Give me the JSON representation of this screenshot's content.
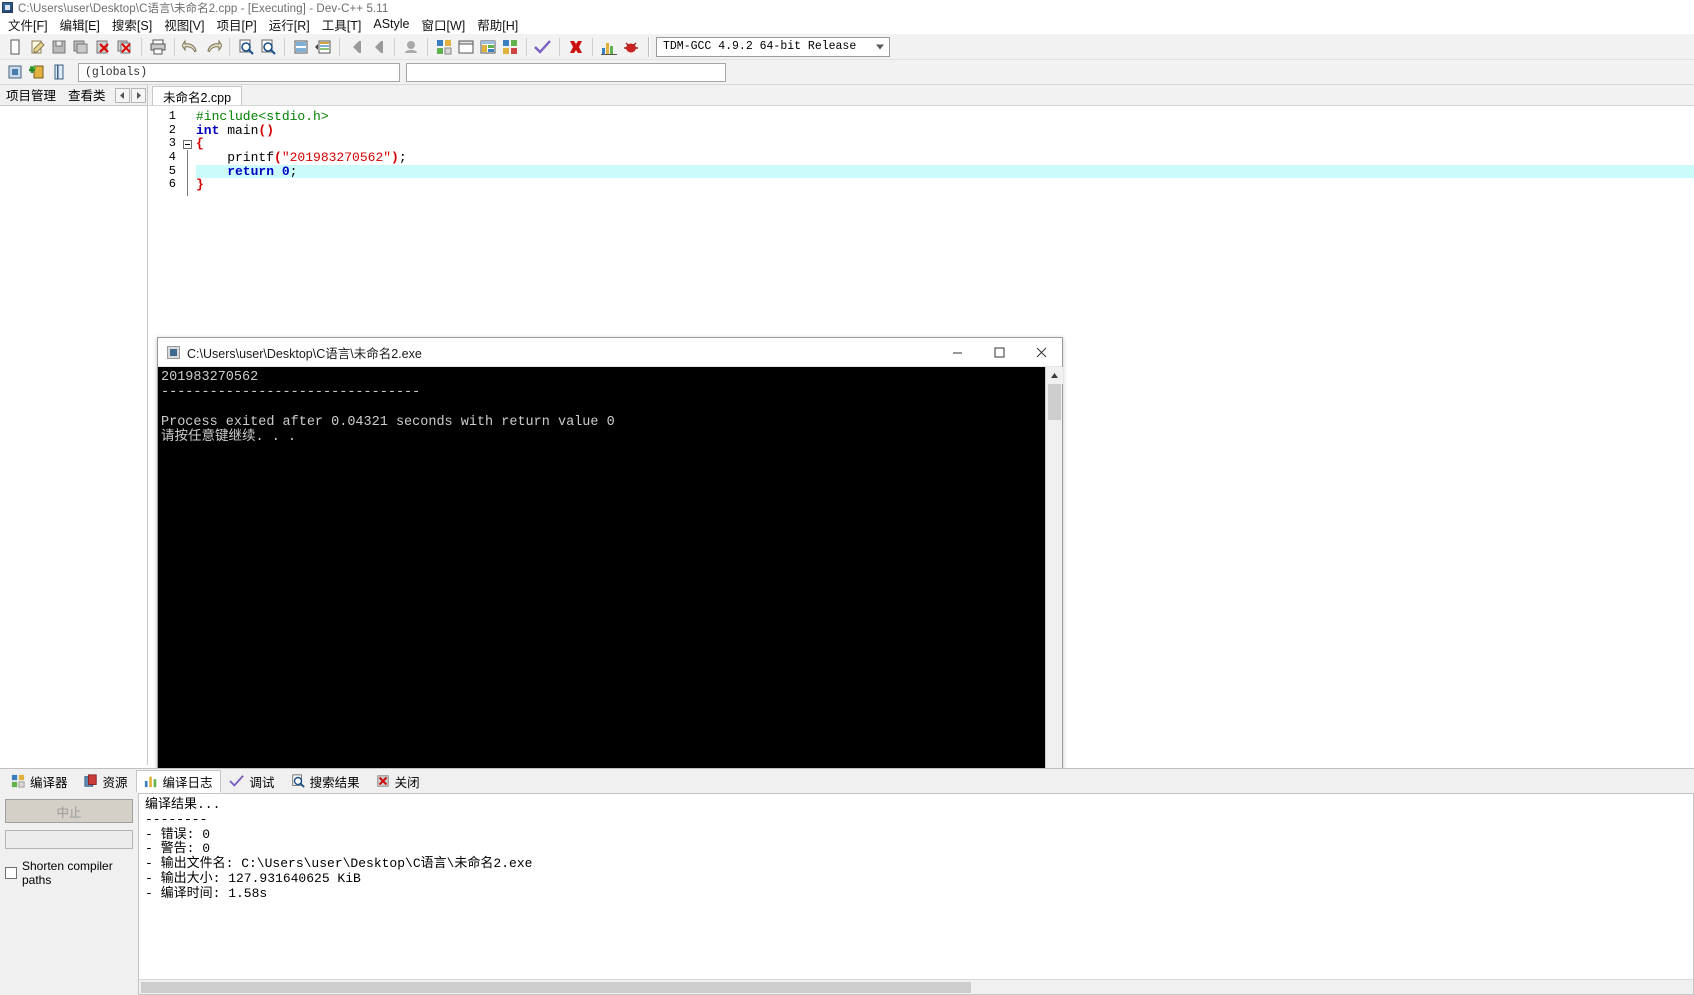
{
  "window": {
    "title": "C:\\Users\\user\\Desktop\\C语言\\未命名2.cpp - [Executing] - Dev-C++ 5.11",
    "icon": "app-icon"
  },
  "menubar": {
    "items": [
      {
        "label": "文件[F]"
      },
      {
        "label": "编辑[E]"
      },
      {
        "label": "搜索[S]"
      },
      {
        "label": "视图[V]"
      },
      {
        "label": "项目[P]"
      },
      {
        "label": "运行[R]"
      },
      {
        "label": "工具[T]"
      },
      {
        "label": "AStyle"
      },
      {
        "label": "窗口[W]"
      },
      {
        "label": "帮助[H]"
      }
    ]
  },
  "toolbar": {
    "buttons": [
      {
        "name": "new-file-icon"
      },
      {
        "name": "open-file-icon"
      },
      {
        "name": "save-file-icon"
      },
      {
        "name": "save-all-icon"
      },
      {
        "name": "close-file-icon"
      },
      {
        "name": "close-all-icon"
      },
      {
        "name": "print-icon"
      },
      {
        "name": "undo-icon"
      },
      {
        "name": "redo-icon"
      },
      {
        "name": "find-icon"
      },
      {
        "name": "replace-icon"
      },
      {
        "name": "goto-line-icon"
      },
      {
        "name": "indent-icon"
      },
      {
        "name": "back-icon"
      },
      {
        "name": "forward-icon"
      },
      {
        "name": "profile-icon"
      },
      {
        "name": "compile-icon"
      },
      {
        "name": "run-icon"
      },
      {
        "name": "compile-run-icon"
      },
      {
        "name": "rebuild-icon"
      },
      {
        "name": "syntax-check-icon"
      },
      {
        "name": "stop-execution-icon"
      },
      {
        "name": "profiling-icon"
      },
      {
        "name": "debug-icon"
      }
    ],
    "compiler_select": {
      "value": "TDM-GCC 4.9.2 64-bit Release"
    }
  },
  "toolbar2": {
    "buttons": [
      {
        "name": "project-browser-icon"
      },
      {
        "name": "add-class-icon"
      },
      {
        "name": "book-icon"
      }
    ],
    "scope_select": {
      "value": "(globals)"
    },
    "member_select": {
      "value": ""
    }
  },
  "left_panel": {
    "tabs": [
      {
        "label": "项目管理"
      },
      {
        "label": "查看类"
      }
    ],
    "nav_prev": "◄",
    "nav_next": "►"
  },
  "editor": {
    "tabs": [
      {
        "label": "未命名2.cpp",
        "active": true
      }
    ],
    "line_numbers": [
      "1",
      "2",
      "3",
      "4",
      "5",
      "6"
    ],
    "highlighted_line": 5,
    "code": [
      {
        "n": 1,
        "tokens": [
          {
            "t": "#include<stdio.h>",
            "c": "pp"
          }
        ]
      },
      {
        "n": 2,
        "tokens": [
          {
            "t": "int",
            "c": "kw"
          },
          {
            "t": " main",
            "c": "fn"
          },
          {
            "t": "()",
            "c": "br"
          }
        ]
      },
      {
        "n": 3,
        "tokens": [
          {
            "t": "{",
            "c": "brace"
          }
        ]
      },
      {
        "n": 4,
        "tokens": [
          {
            "t": "    printf",
            "c": "fn"
          },
          {
            "t": "(",
            "c": "br"
          },
          {
            "t": "\"201983270562\"",
            "c": "str"
          },
          {
            "t": ")",
            "c": "br"
          },
          {
            "t": ";",
            "c": "fn"
          }
        ]
      },
      {
        "n": 5,
        "tokens": [
          {
            "t": "    return",
            "c": "kw"
          },
          {
            "t": " ",
            "c": "fn"
          },
          {
            "t": "0",
            "c": "num"
          },
          {
            "t": ";",
            "c": "fn"
          }
        ]
      },
      {
        "n": 6,
        "tokens": [
          {
            "t": "}",
            "c": "brace"
          }
        ]
      }
    ]
  },
  "console": {
    "title": "C:\\Users\\user\\Desktop\\C语言\\未命名2.exe",
    "minimize_label": "─",
    "maximize_label": "☐",
    "close_label": "✕",
    "output_lines": [
      "201983270562",
      "--------------------------------",
      "Process exited after 0.04321 seconds with return value 0",
      "请按任意键继续. . ."
    ],
    "scroll_up": "▲",
    "scroll_down": "▼"
  },
  "bottom_panel": {
    "tabs": [
      {
        "label": "编译器",
        "icon": "compiler-icon",
        "active": false
      },
      {
        "label": "资源",
        "icon": "resource-icon",
        "active": false
      },
      {
        "label": "编译日志",
        "icon": "compile-log-icon",
        "active": true
      },
      {
        "label": "调试",
        "icon": "debug-check-icon",
        "active": false
      },
      {
        "label": "搜索结果",
        "icon": "search-results-icon",
        "active": false
      },
      {
        "label": "关闭",
        "icon": "close-tab-icon",
        "active": false
      }
    ],
    "abort_button": "中止",
    "shorten_paths_label": "Shorten compiler paths",
    "log_lines": [
      "编译结果...",
      "--------",
      "- 错误: 0",
      "- 警告: 0",
      "- 输出文件名: C:\\Users\\user\\Desktop\\C语言\\未命名2.exe",
      "- 输出大小: 127.931640625 KiB",
      "- 编译时间: 1.58s"
    ]
  },
  "colors": {
    "keyword": "#0000c0",
    "string": "#d40000",
    "preprocessor": "#008000",
    "highlight_line": "#ccfbfb",
    "console_bg": "#000000",
    "console_fg": "#cccccc"
  }
}
